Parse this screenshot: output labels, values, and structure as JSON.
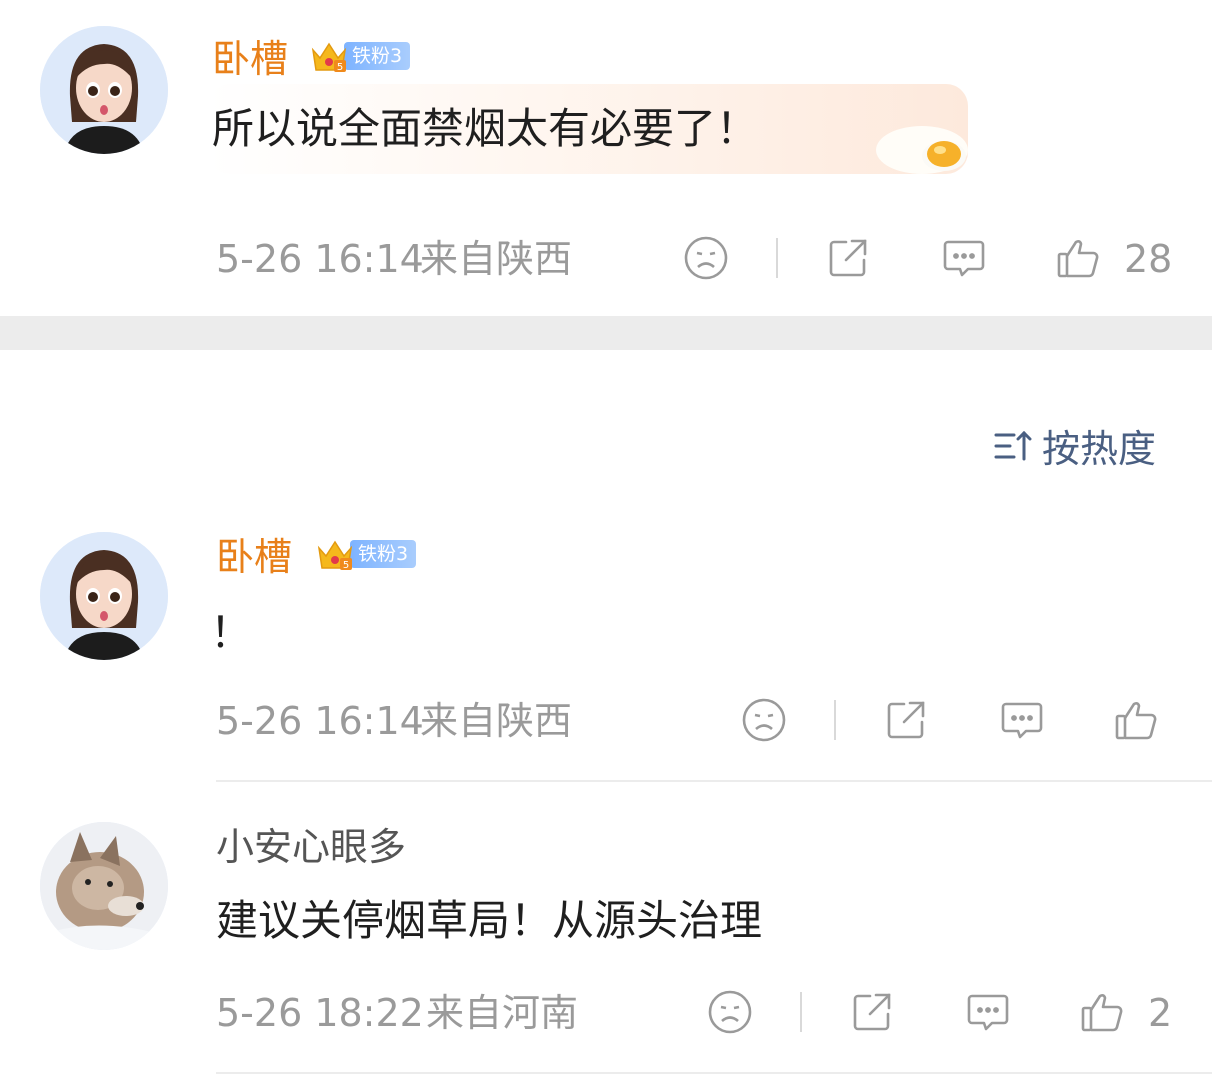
{
  "comments": [
    {
      "username": "卧槽",
      "badge_label": "铁粉3",
      "text": "所以说全面禁烟太有必要了！",
      "time": "5-26 16:14",
      "location": "来自陕西",
      "likes": "28"
    },
    {
      "username": "卧槽",
      "badge_label": "铁粉3",
      "text": "！",
      "time": "5-26 16:14",
      "location": "来自陕西",
      "likes": ""
    },
    {
      "username": "小安心眼多",
      "text": "建议关停烟草局！从源头治理",
      "time": "5-26 18:22",
      "location": "来自河南",
      "likes": "2"
    }
  ],
  "sort": {
    "label": "按热度"
  },
  "colors": {
    "username_highlight": "#e8801a",
    "sort_text": "#4a5f82",
    "badge_blue": "#7db3ff",
    "meta_gray": "#9a9a9a"
  },
  "icons": [
    "dislike-face-icon",
    "share-icon",
    "comment-icon",
    "like-thumb-icon",
    "sort-icon",
    "crown-icon"
  ]
}
